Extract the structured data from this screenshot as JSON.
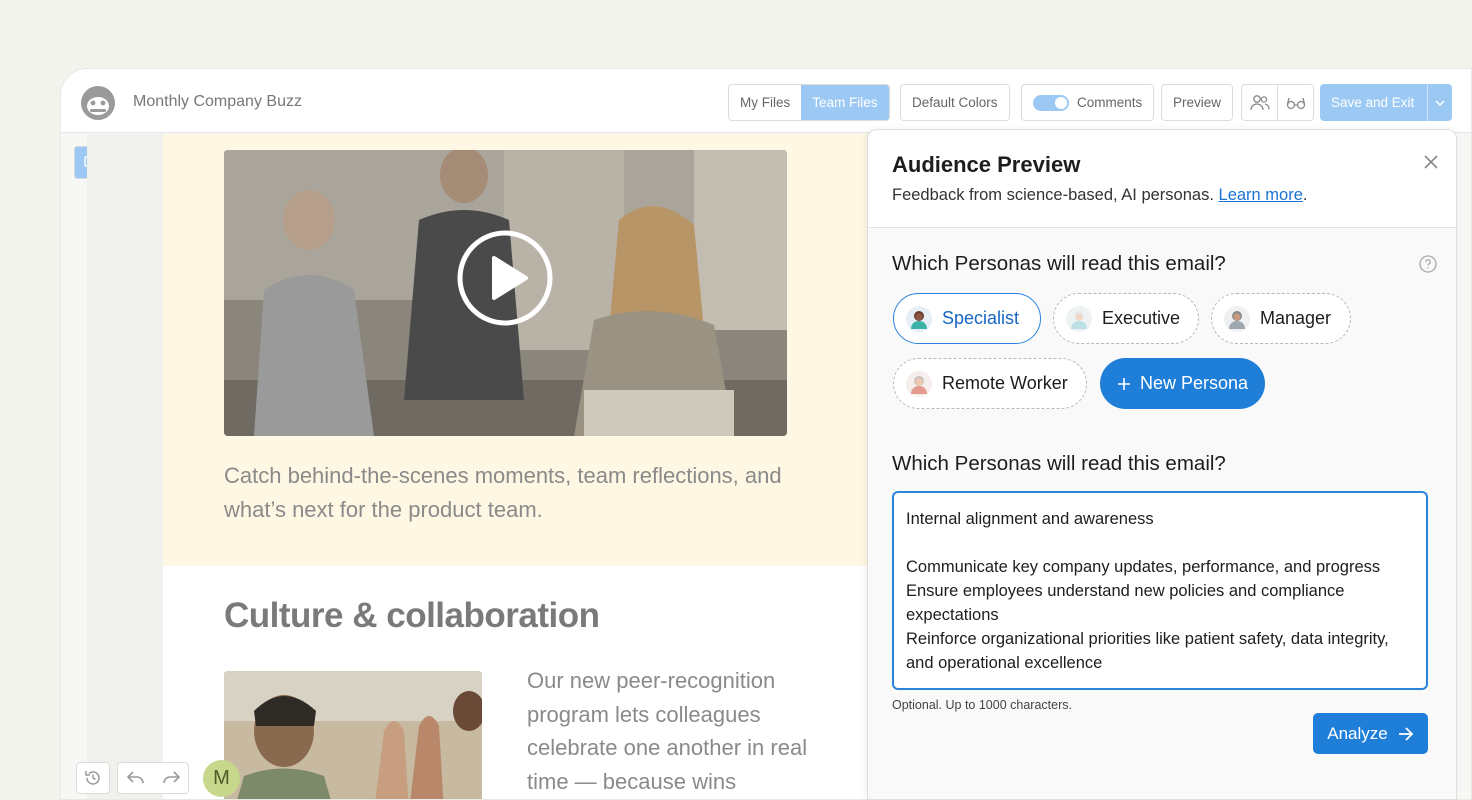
{
  "app": {
    "doc_title": "Monthly Company Buzz"
  },
  "toolbar": {
    "my_files": "My Files",
    "team_files": "Team Files",
    "default_colors": "Default Colors",
    "comments": "Comments",
    "preview": "Preview",
    "save_exit": "Save and Exit"
  },
  "email": {
    "hero_text": "Catch behind-the-scenes moments, team reflections, and what’s next for the product team.",
    "culture_heading": "Culture & collaboration",
    "body_text": "Our new peer-recognition program lets colleagues celebrate one another in real time — because wins"
  },
  "user": {
    "initial": "M"
  },
  "panel": {
    "title": "Audience Preview",
    "subtitle": "Feedback from science-based, AI personas.",
    "learn_more": "Learn more",
    "period": ".",
    "question1": "Which Personas will read this email?",
    "personas": [
      "Specialist",
      "Executive",
      "Manager",
      "Remote Worker"
    ],
    "new_persona": "New Persona",
    "question2": "Which Personas will read this email?",
    "goals_text": "Internal alignment and awareness\n\nCommunicate key company updates, performance, and progress\nEnsure employees understand new policies and compliance expectations\nReinforce organizational priorities like patient safety, data integrity, and operational excellence",
    "hint": "Optional. Up to 1000 characters.",
    "analyze": "Analyze"
  },
  "colors": {
    "accent": "#1f7ed8",
    "accent_light": "#9cc9f3",
    "hero_bg": "#fdf7e3"
  }
}
